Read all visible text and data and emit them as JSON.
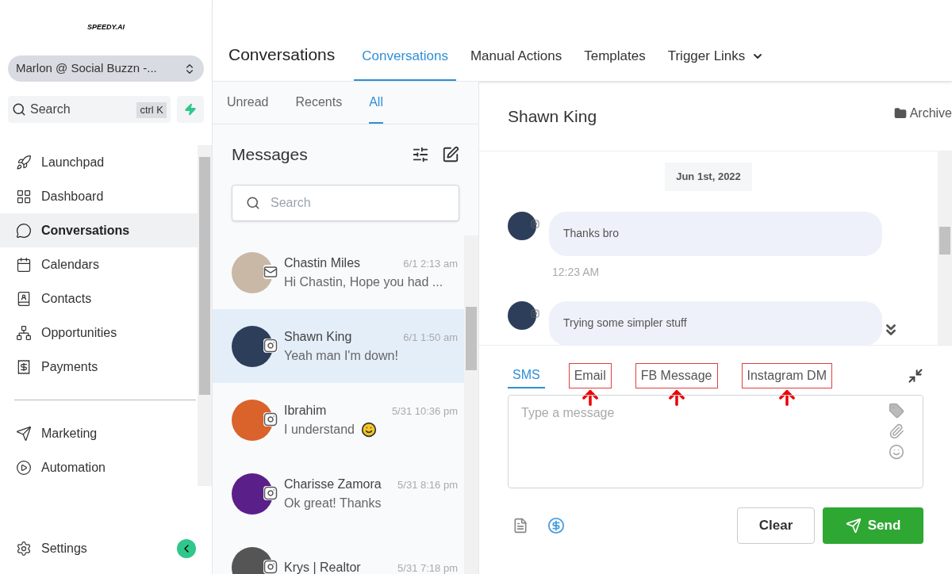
{
  "sidebar": {
    "logo": "SPEEDY.AI",
    "account": "Marlon @ Social Buzzn -...",
    "search": {
      "placeholder": "Search",
      "shortcut": "ctrl K"
    },
    "items": [
      {
        "label": "Launchpad",
        "selected": false
      },
      {
        "label": "Dashboard",
        "selected": false
      },
      {
        "label": "Conversations",
        "selected": true
      },
      {
        "label": "Calendars",
        "selected": false
      },
      {
        "label": "Contacts",
        "selected": false
      },
      {
        "label": "Opportunities",
        "selected": false
      },
      {
        "label": "Payments",
        "selected": false
      }
    ],
    "items_2": [
      {
        "label": "Marketing",
        "selected": false
      },
      {
        "label": "Automation",
        "selected": false
      }
    ],
    "settings": "Settings"
  },
  "header": {
    "title": "Conversations",
    "tabs": [
      {
        "label": "Conversations",
        "selected": true,
        "dropdown": false
      },
      {
        "label": "Manual Actions",
        "selected": false,
        "dropdown": false
      },
      {
        "label": "Templates",
        "selected": false,
        "dropdown": false
      },
      {
        "label": "Trigger Links",
        "selected": false,
        "dropdown": true
      }
    ]
  },
  "inbox": {
    "filters": [
      {
        "label": "Unread",
        "selected": false
      },
      {
        "label": "Recents",
        "selected": false
      },
      {
        "label": "All",
        "selected": true
      }
    ],
    "title": "Messages",
    "search": {
      "placeholder": "Search"
    },
    "conversations": [
      {
        "name": "Chastin Miles",
        "time": "6/1 2:13 am",
        "preview": "Hi Chastin, Hope you had ...",
        "kind": "email",
        "selected": false,
        "emoji": false
      },
      {
        "name": "Shawn King",
        "time": "6/1 1:50 am",
        "preview": "Yeah man I'm down!",
        "kind": "instagram",
        "selected": true,
        "emoji": false
      },
      {
        "name": "Ibrahim",
        "time": "5/31 10:36 pm",
        "preview": "I understand",
        "kind": "instagram",
        "selected": false,
        "emoji": true
      },
      {
        "name": "Charisse Zamora",
        "time": "5/31 8:16 pm",
        "preview": "Ok great! Thanks",
        "kind": "instagram",
        "selected": false,
        "emoji": false
      },
      {
        "name": "Krys | Realtor",
        "time": "5/31 7:18 pm",
        "kind": "instagram",
        "selected": false,
        "emoji": false
      }
    ]
  },
  "chat": {
    "contact": "Shawn King",
    "archive": "Archive",
    "date": "Jun 1st, 2022",
    "messages": [
      {
        "text": "Thanks bro",
        "time": "12:23 AM"
      },
      {
        "text": "Trying some simpler stuff"
      }
    ],
    "composer": {
      "channels": [
        {
          "label": "SMS",
          "selected": true,
          "highlighted": false
        },
        {
          "label": "Email",
          "selected": false,
          "highlighted": true
        },
        {
          "label": "FB Message",
          "selected": false,
          "highlighted": true
        },
        {
          "label": "Instagram DM",
          "selected": false,
          "highlighted": true
        }
      ],
      "placeholder": "Type a message",
      "clear": "Clear",
      "send": "Send"
    }
  }
}
